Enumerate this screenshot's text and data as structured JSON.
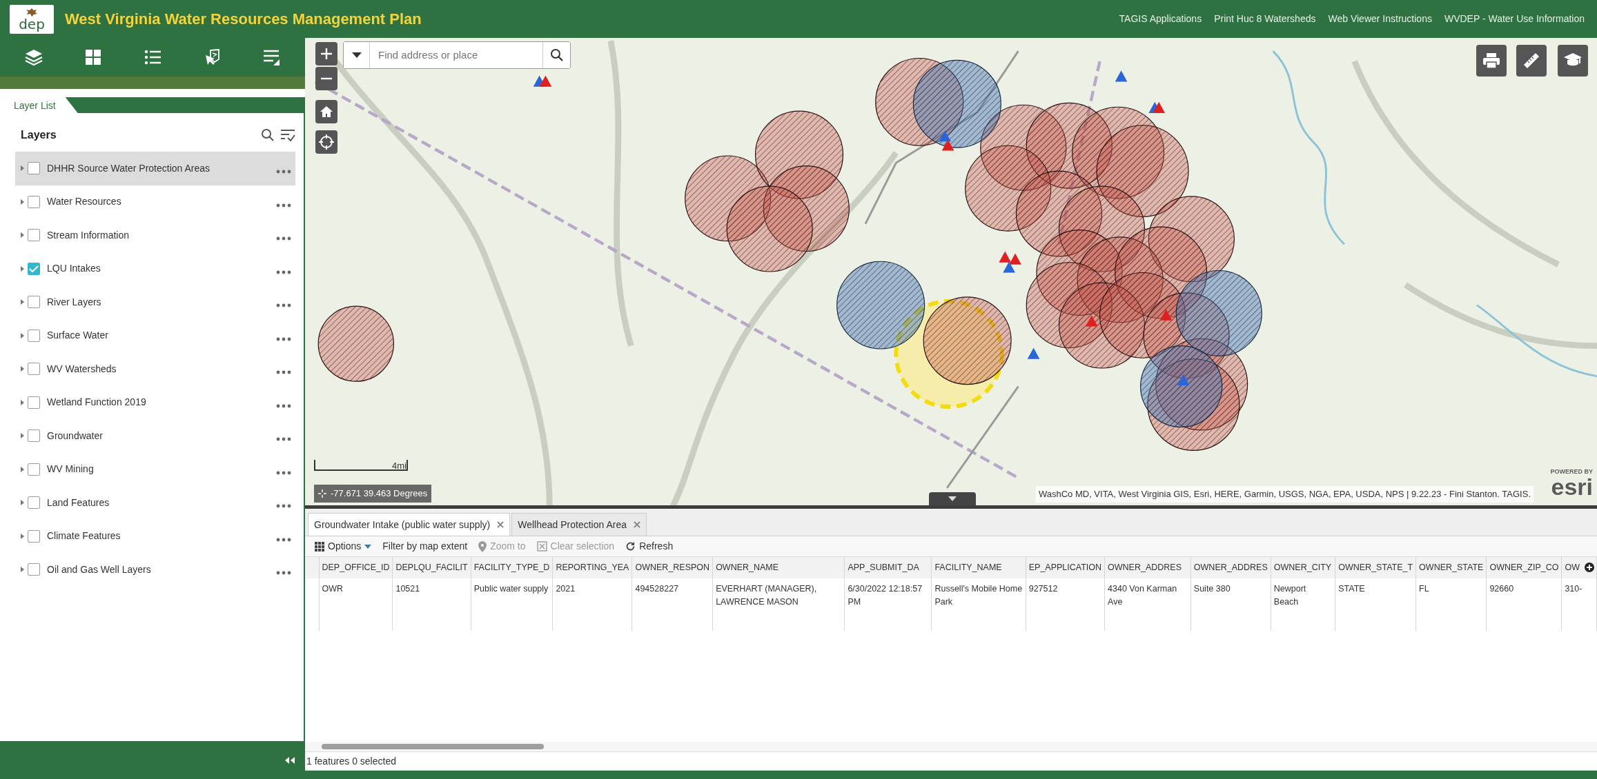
{
  "header": {
    "logo_text": "dep",
    "title": "West Virginia Water Resources Management Plan",
    "links": [
      "TAGIS Applications",
      "Print Huc 8 Watersheds",
      "Web Viewer Instructions",
      "WVDEP - Water Use Information"
    ]
  },
  "widget_toolbar": [
    {
      "kind": "layers"
    },
    {
      "kind": "basemap"
    },
    {
      "kind": "legend"
    },
    {
      "kind": "select"
    },
    {
      "kind": "attributes"
    }
  ],
  "layer_panel": {
    "tab": "Layer List",
    "title": "Layers",
    "layers": [
      {
        "name": "DHHR Source Water Protection Areas",
        "checked": false,
        "highlighted": true
      },
      {
        "name": "Water Resources",
        "checked": false,
        "highlighted": false
      },
      {
        "name": "Stream Information",
        "checked": false,
        "highlighted": false
      },
      {
        "name": "LQU Intakes",
        "checked": true,
        "highlighted": false
      },
      {
        "name": "River Layers",
        "checked": false,
        "highlighted": false
      },
      {
        "name": "Surface Water",
        "checked": false,
        "highlighted": false
      },
      {
        "name": "WV Watersheds",
        "checked": false,
        "highlighted": false
      },
      {
        "name": "Wetland Function 2019",
        "checked": false,
        "highlighted": false
      },
      {
        "name": "Groundwater",
        "checked": false,
        "highlighted": false
      },
      {
        "name": "WV Mining",
        "checked": false,
        "highlighted": false
      },
      {
        "name": "Land Features",
        "checked": false,
        "highlighted": false
      },
      {
        "name": "Climate Features",
        "checked": false,
        "highlighted": false
      },
      {
        "name": "Oil and Gas Well Layers",
        "checked": false,
        "highlighted": false
      }
    ]
  },
  "map": {
    "search": {
      "placeholder": "Find address or place"
    },
    "scale": "4mi",
    "coordinates": "-77.671 39.463 Degrees",
    "attribution": "WashCo MD, VITA, West Virginia GIS, Esri, HERE, Garmin, USGS, NGA, EPA, USDA, NPS | 9.22.23 - Fini Stanton. TAGIS.",
    "logo_caption": "POWERED BY",
    "logo": "esri"
  },
  "attribute_table": {
    "tabs": [
      {
        "label": "Groundwater Intake (public water supply)",
        "selected": true
      },
      {
        "label": "Wellhead Protection Area",
        "selected": false
      }
    ],
    "toolbar": [
      {
        "kind": "options",
        "label": "Options",
        "disabled": false
      },
      {
        "kind": "filter",
        "label": "Filter by map extent",
        "disabled": false
      },
      {
        "kind": "zoom",
        "label": "Zoom to",
        "disabled": true
      },
      {
        "kind": "clear",
        "label": "Clear selection",
        "disabled": true
      },
      {
        "kind": "refresh",
        "label": "Refresh",
        "disabled": false
      }
    ],
    "columns": [
      "DEP_OFFICE_ID",
      "DEPLQU_FACILIT",
      "FACILITY_TYPE_D",
      "REPORTING_YEA",
      "OWNER_RESPON",
      "OWNER_NAME",
      "APP_SUBMIT_DA",
      "FACILITY_NAME",
      "EP_APPLICATION",
      "OWNER_ADDRES",
      "OWNER_ADDRES",
      "OWNER_CITY",
      "OWNER_STATE_T",
      "OWNER_STATE",
      "OWNER_ZIP_CO",
      "OW"
    ],
    "rows": [
      [
        "OWR",
        "10521",
        "Public water supply",
        "2021",
        "494528227",
        "EVERHART (MANAGER), LAWRENCE MASON",
        "6/30/2022 12:18:57 PM",
        "Russell's Mobile Home Park",
        "927512",
        "4340 Von Karman Ave",
        "Suite 380",
        "Newport Beach",
        "STATE",
        "FL",
        "92660",
        "310-"
      ]
    ],
    "status": "1 features 0 selected"
  }
}
